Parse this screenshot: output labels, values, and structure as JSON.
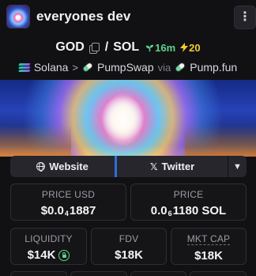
{
  "header": {
    "title": "everyones dev",
    "menu_icon": "more-vertical-icon",
    "menu_label": "⋮"
  },
  "pair": {
    "base": "GOD",
    "separator": "/",
    "quote": "SOL",
    "age": "16m",
    "age_color": "#5fd38a",
    "boosts": "20",
    "boost_color": "#f3cb33"
  },
  "route": {
    "chain": "Solana",
    "arrow": ">",
    "dex": "PumpSwap",
    "via": "via",
    "launchpad": "Pump.fun"
  },
  "links": {
    "website": "Website",
    "twitter": "Twitter",
    "accent_color": "#2f6fd6"
  },
  "stats": {
    "price_usd": {
      "label": "PRICE USD",
      "prefix": "$0.0",
      "zeros": "4",
      "suffix": "1887"
    },
    "price_native": {
      "label": "PRICE",
      "prefix": "0.0",
      "zeros": "6",
      "suffix": "1180 SOL"
    },
    "liquidity": {
      "label": "LIQUIDITY",
      "value": "$14K"
    },
    "fdv": {
      "label": "FDV",
      "value": "$18K"
    },
    "mkt_cap": {
      "label": "MKT CAP",
      "value": "$18K"
    }
  }
}
